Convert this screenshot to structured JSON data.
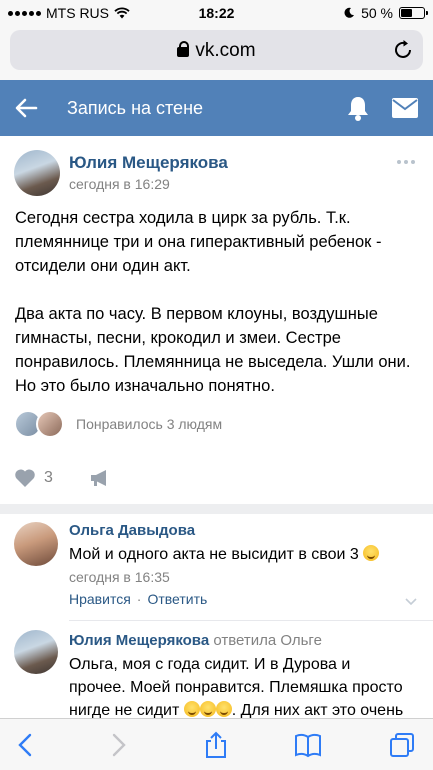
{
  "status": {
    "carrier": "MTS RUS",
    "time": "18:22",
    "battery": "50 %",
    "battery_level": 0.5
  },
  "browser": {
    "domain": "vk.com"
  },
  "header": {
    "title": "Запись на стене"
  },
  "post": {
    "author": "Юлия Мещерякова",
    "time": "сегодня в 16:29",
    "text": "Сегодня сестра ходила в цирк за рубль. Т.к. племяннице три и она гиперактивный ребенок - отсидели они один акт.\n\nДва акта по часу. В первом клоуны, воздушные гимнасты, песни, крокодил и змеи. Сестре понравилось. Племянница не выседела. Ушли они. Но это было изначально понятно.",
    "likes_text": "Понравилось 3 людям",
    "like_count": "3"
  },
  "comments": [
    {
      "author": "Ольга Давыдова",
      "text": "Мой и одного акта не высидит в свои 3",
      "time": "сегодня в 16:35",
      "like_label": "Нравится",
      "reply_label": "Ответить"
    },
    {
      "author": "Юлия Мещерякова",
      "reply_to": "ответила Ольге",
      "text_line1": "Ольга, моя с года сидит. И в Дурова и",
      "text_line2": "прочее. Моей понравится. Племяшка просто",
      "text_line3a": "нигде не сидит",
      "text_line3b": ". Для них акт это очень"
    }
  ],
  "colors": {
    "vk_blue": "#5181b8",
    "link": "#2a5885",
    "muted": "#828282"
  }
}
